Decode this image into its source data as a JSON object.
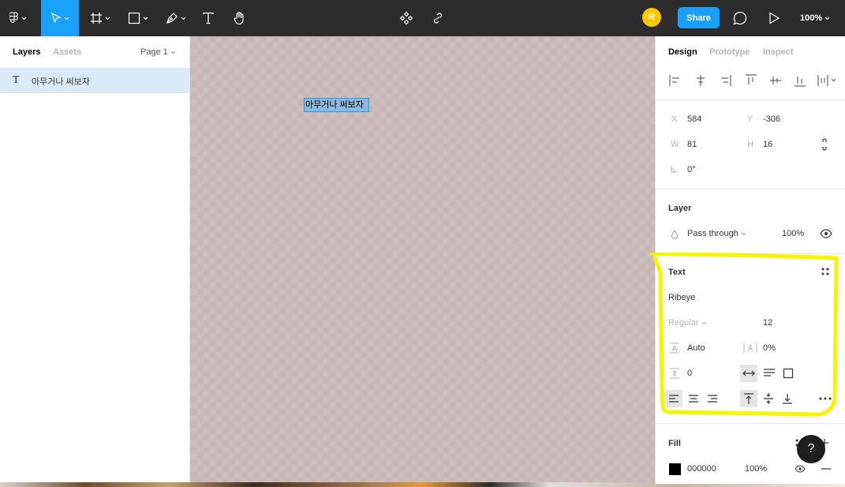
{
  "toolbar": {
    "tools": [
      "main-menu",
      "move",
      "frame",
      "shape",
      "pen",
      "text",
      "hand"
    ],
    "avatar_initial": "R",
    "share_label": "Share",
    "zoom_label": "100%",
    "accent_color": "#18a0fb"
  },
  "left_panel": {
    "tab_layers": "Layers",
    "tab_assets": "Assets",
    "page_label": "Page 1",
    "layers": [
      {
        "icon": "text-layer-icon",
        "name": "아무거나 써보자"
      }
    ]
  },
  "canvas": {
    "text_content": "아무거나 써보자"
  },
  "right_panel": {
    "tabs": {
      "design": "Design",
      "prototype": "Prototype",
      "inspect": "Inspect"
    },
    "position": {
      "x_label": "X",
      "x_value": "584",
      "y_label": "Y",
      "y_value": "-306",
      "w_label": "W",
      "w_value": "81",
      "h_label": "H",
      "h_value": "16",
      "rotation_value": "0°"
    },
    "layer": {
      "title": "Layer",
      "blend_mode": "Pass through",
      "opacity": "100%"
    },
    "text": {
      "title": "Text",
      "font_family": "Ribeye",
      "font_weight": "Regular",
      "font_size": "12",
      "line_height": "Auto",
      "letter_spacing": "0%",
      "paragraph_spacing": "0"
    },
    "fill": {
      "title": "Fill",
      "color_hex": "000000",
      "opacity": "100%",
      "swatch_color": "#000000"
    }
  },
  "help_label": "?",
  "annotation_color": "#ffff00"
}
